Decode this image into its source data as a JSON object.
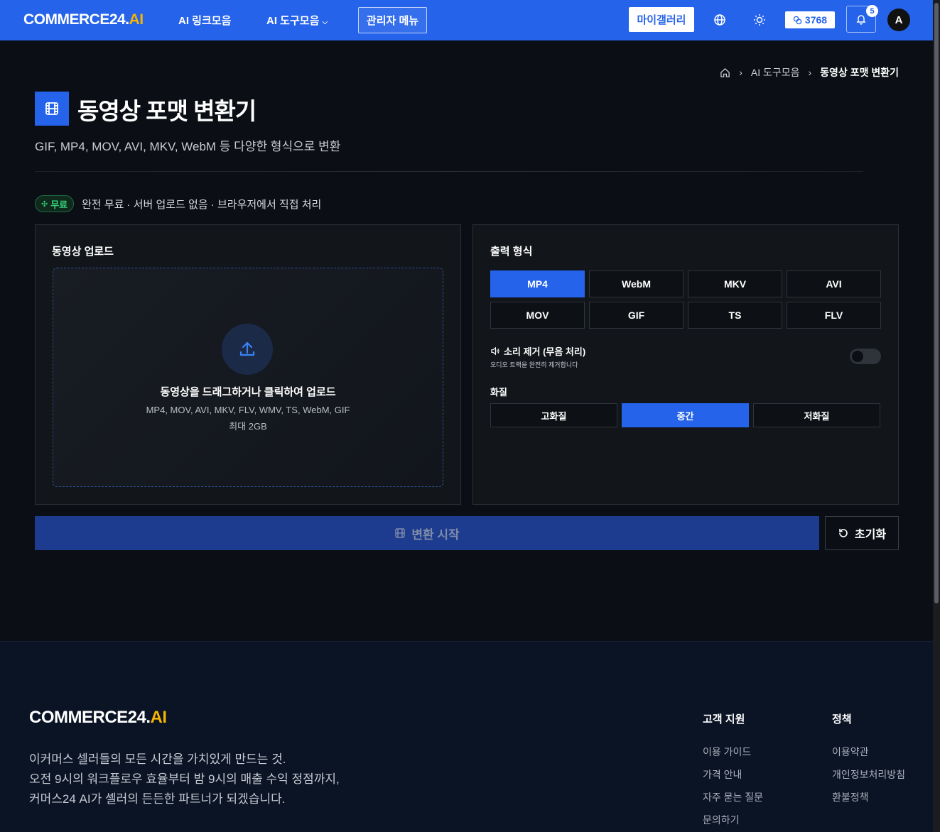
{
  "header": {
    "logo_main": "COMMERCE24.",
    "logo_ai": "AI",
    "nav_links": "AI 링크모음",
    "nav_tools": "AI 도구모음",
    "admin_menu": "관리자 메뉴",
    "my_gallery": "마이갤러리",
    "credits": "3768",
    "notifications": "5",
    "avatar": "A"
  },
  "breadcrumb": {
    "parent": "AI 도구모음",
    "current": "동영상 포맷 변환기"
  },
  "page": {
    "title": "동영상 포맷 변환기",
    "subtitle": "GIF, MP4, MOV, AVI, MKV, WebM 등 다양한 형식으로 변환",
    "free_badge": "무료",
    "free_text": "완전 무료 · 서버 업로드 없음 · 브라우저에서 직접 처리"
  },
  "upload": {
    "title": "동영상 업로드",
    "main_text": "동영상을 드래그하거나 클릭하여 업로드",
    "formats": "MP4, MOV, AVI, MKV, FLV, WMV, TS, WebM, GIF",
    "max_size": "최대 2GB"
  },
  "output": {
    "title": "출력 형식",
    "formats": [
      "MP4",
      "WebM",
      "MKV",
      "AVI",
      "MOV",
      "GIF",
      "TS",
      "FLV"
    ],
    "selected_format": "MP4",
    "mute_label": "소리 제거 (무음 처리)",
    "mute_desc": "오디오 트랙을 완전히 제거합니다",
    "mute_enabled": false,
    "quality_label": "화질",
    "quality_options": [
      "고화질",
      "중간",
      "저화질"
    ],
    "selected_quality": "중간"
  },
  "actions": {
    "convert": "변환 시작",
    "reset": "초기화"
  },
  "footer": {
    "logo_main": "COMMERCE24.",
    "logo_ai": "AI",
    "desc_line1": "이커머스 셀러들의 모든 시간을 가치있게 만드는 것.",
    "desc_line2": "오전 9시의 워크플로우 효율부터 밤 9시의 매출 수익 정점까지,",
    "desc_line3": "커머스24 AI가 셀러의 든든한 파트너가 되겠습니다.",
    "support_title": "고객 지원",
    "support_links": [
      "이용 가이드",
      "가격 안내",
      "자주 묻는 질문",
      "문의하기"
    ],
    "policy_title": "정책",
    "policy_links": [
      "이용약관",
      "개인정보처리방침",
      "환불정책"
    ]
  },
  "colors": {
    "accent": "#2563eb",
    "brand_ai": "#f5b400",
    "background": "#0b0e14",
    "free_green": "#34d17a"
  }
}
